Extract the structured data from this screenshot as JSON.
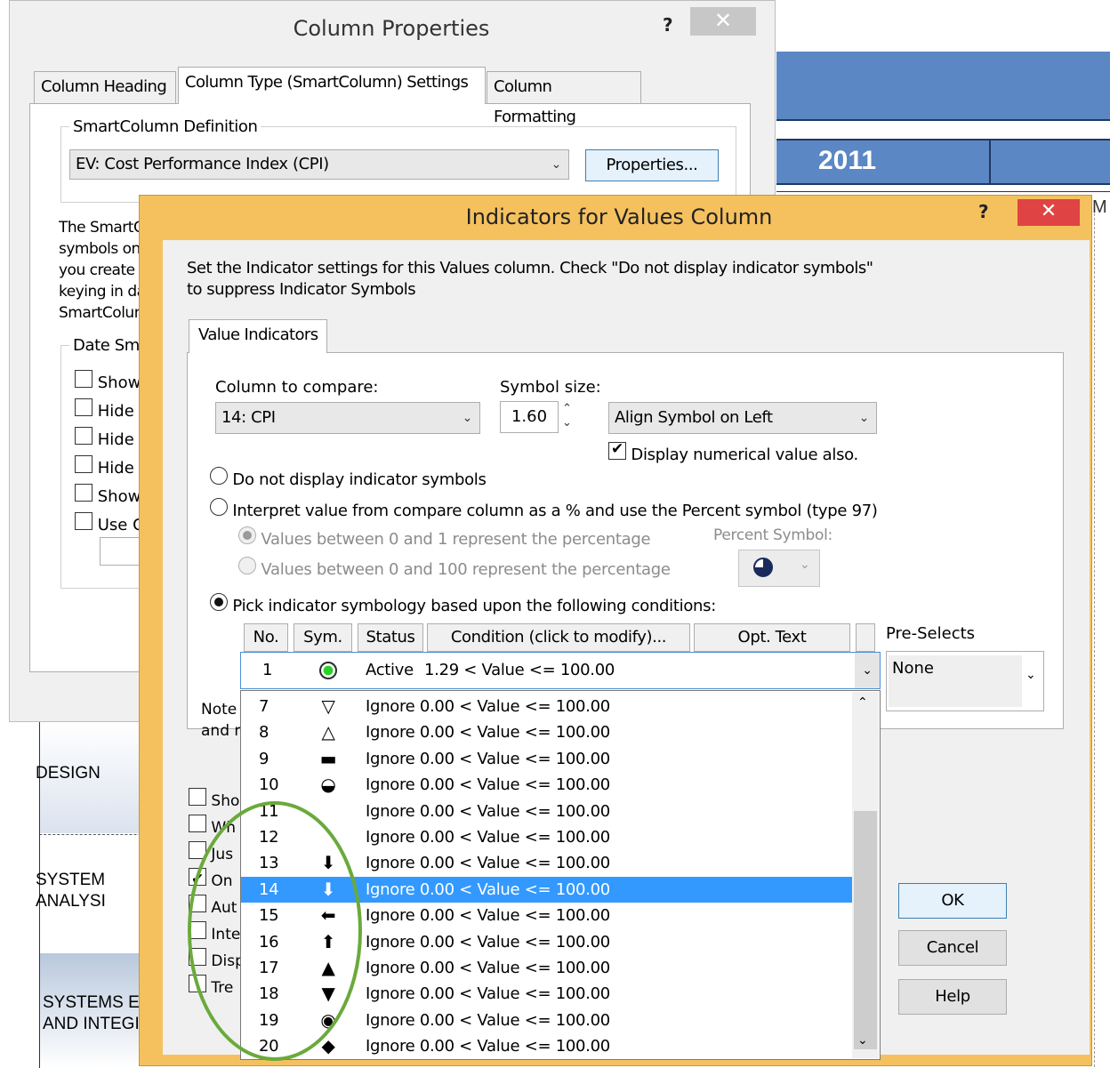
{
  "background": {
    "year": "2011",
    "partial_col": "M",
    "rows": [
      "DESIGN",
      "SYSTEM\nANALYSI",
      "SYSTEMS E\nAND INTEGI"
    ]
  },
  "column_properties": {
    "title": "Column Properties",
    "help": "?",
    "close": "✕",
    "tabs": [
      "Column Heading",
      "Column Type (SmartColumn) Settings",
      "Column Formatting"
    ],
    "smartcolumn_group_label": "SmartColumn Definition",
    "definition_value": "EV: Cost Performance Index (CPI)",
    "properties_button": "Properties...",
    "description_lines": [
      "The SmartC",
      "symbols on",
      "you create",
      "keying in da",
      "SmartColum"
    ],
    "date_group_label": "Date Sma",
    "date_checkboxes": [
      "Show T",
      "Hide Y",
      "Hide M",
      "Hide T",
      "Show",
      "Use Cu"
    ]
  },
  "indicators": {
    "title": "Indicators for Values Column",
    "help": "?",
    "close": "✕",
    "instructions_line1": "Set the Indicator settings for this Values column. Check \"Do not display indicator symbols\"",
    "instructions_line2": "to suppress Indicator Symbols",
    "tab": "Value Indicators",
    "compare_label": "Column to compare:",
    "compare_value": "14: CPI",
    "size_label": "Symbol size:",
    "size_value": "1.60",
    "align_value": "Align Symbol on Left",
    "display_numerical_label": "Display numerical value also.",
    "opt_none": "Do not display indicator symbols",
    "opt_percent": "Interpret value from compare column as a % and use the Percent symbol (type 97)",
    "opt_percent_a": "Values between 0 and 1 represent the percentage",
    "opt_percent_b": "Values between 0 and 100 represent the percentage",
    "percent_symbol_label": "Percent Symbol:",
    "opt_pick": "Pick indicator symbology based upon the following conditions:",
    "headers": [
      "No.",
      "Sym.",
      "Status",
      "Condition (click to modify)...",
      "Opt. Text"
    ],
    "preselects_label": "Pre-Selects",
    "preselects_value": "None",
    "selected_row": {
      "no": "1",
      "status": "Active",
      "condition": "1.29 < Value <= 100.00"
    },
    "note_lines": [
      "Note",
      "and r"
    ],
    "lower_checkboxes": [
      "Sho",
      "Wh",
      "Jus",
      "On",
      "Aut",
      "Inte",
      "Disp",
      "Tre"
    ],
    "rows": [
      {
        "no": "7",
        "sym": "▽",
        "cond": "Ignore 0.00 < Value <= 100.00"
      },
      {
        "no": "8",
        "sym": "△",
        "cond": "Ignore 0.00 < Value <= 100.00"
      },
      {
        "no": "9",
        "sym": "▬",
        "cond": "Ignore 0.00 < Value <= 100.00"
      },
      {
        "no": "10",
        "sym": "◒",
        "cond": "Ignore 0.00 < Value <= 100.00"
      },
      {
        "no": "11",
        "sym": "",
        "cond": "Ignore 0.00 < Value <= 100.00"
      },
      {
        "no": "12",
        "sym": "",
        "cond": "Ignore 0.00 < Value <= 100.00"
      },
      {
        "no": "13",
        "sym": "⬇",
        "cond": "Ignore 0.00 < Value <= 100.00"
      },
      {
        "no": "14",
        "sym": "⬇",
        "cond": "Ignore 0.00 < Value <= 100.00",
        "selected": true
      },
      {
        "no": "15",
        "sym": "⬅",
        "cond": "Ignore 0.00 < Value <= 100.00"
      },
      {
        "no": "16",
        "sym": "⬆",
        "cond": "Ignore 0.00 < Value <= 100.00"
      },
      {
        "no": "17",
        "sym": "▲",
        "cond": "Ignore 0.00 < Value <= 100.00"
      },
      {
        "no": "18",
        "sym": "▼",
        "cond": "Ignore 0.00 < Value <= 100.00"
      },
      {
        "no": "19",
        "sym": "◉",
        "cond": "Ignore 0.00 < Value <= 100.00"
      },
      {
        "no": "20",
        "sym": "◆",
        "cond": "Ignore 0.00 < Value <= 100.00"
      }
    ],
    "ok": "OK",
    "cancel": "Cancel",
    "help_button": "Help"
  }
}
